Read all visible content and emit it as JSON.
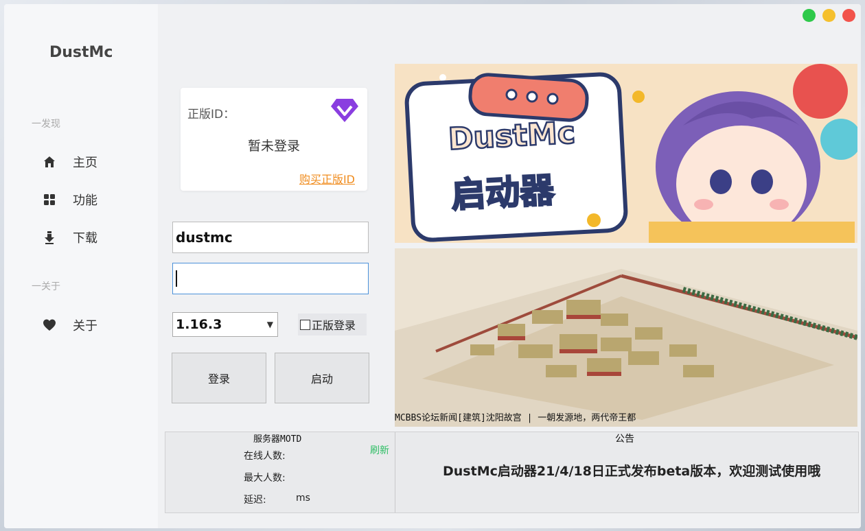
{
  "app": {
    "title": "DustMc"
  },
  "window_controls": {
    "colors": [
      "#2ec94a",
      "#f5c02e",
      "#f2534b"
    ],
    "names": [
      "maximize",
      "minimize",
      "close"
    ]
  },
  "sidebar": {
    "section_discover": "一发现",
    "section_about": "一关于",
    "items": [
      {
        "label": "主页",
        "icon": "home-icon"
      },
      {
        "label": "功能",
        "icon": "grid-icon"
      },
      {
        "label": "下载",
        "icon": "download-icon"
      },
      {
        "label": "关于",
        "icon": "heart-icon"
      }
    ]
  },
  "account_card": {
    "label": "正版ID：",
    "status": "暂未登录",
    "buy_link": "购买正版ID",
    "icon": "diamond-icon",
    "accent": "#8a3ee0"
  },
  "login": {
    "username": "dustmc",
    "password": "",
    "version": "1.16.3",
    "official_login_label": "正版登录",
    "official_login_checked": false,
    "login_button": "登录",
    "launch_button": "启动"
  },
  "banner": {
    "line1": "DustMc",
    "line2": "启动器"
  },
  "news": {
    "caption": "MCBBS论坛新闻[建筑]沈阳故宫 | 一朝发源地，两代帝王都"
  },
  "server": {
    "title": "服务器MOTD",
    "refresh": "刷新",
    "online_label": "在线人数:",
    "max_label": "最大人数:",
    "latency_label": "延迟:",
    "latency_unit": "ms"
  },
  "notice": {
    "title": "公告",
    "text": "DustMc启动器21/4/18日正式发布beta版本，欢迎测试使用哦"
  }
}
